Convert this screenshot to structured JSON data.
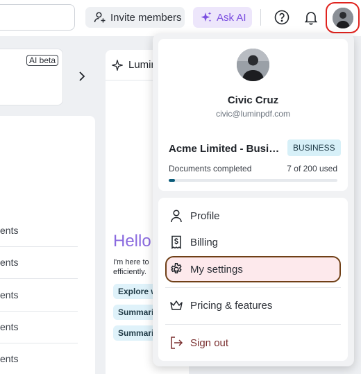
{
  "topbar": {
    "invite_label": "Invite members",
    "ask_ai_label": "Ask AI"
  },
  "background": {
    "ai_beta_label": "AI beta",
    "panel_title": "Lumin",
    "greeting": "Hello",
    "intro_lines": [
      "I'm here to",
      "efficiently."
    ],
    "chips": [
      "Explore w",
      "Summari",
      "Summari"
    ],
    "doc_rows": [
      "ents",
      "ents",
      "ents",
      "ents",
      "ents"
    ]
  },
  "user": {
    "name": "Civic Cruz",
    "email": "civic@luminpdf.com"
  },
  "organization": {
    "name": "Acme Limited - Business",
    "plan": "BUSINESS",
    "docs_label": "Documents completed",
    "docs_count": "7 of 200 used",
    "progress": 0.035
  },
  "menu": {
    "profile": "Profile",
    "billing": "Billing",
    "settings": "My settings",
    "pricing": "Pricing & features",
    "signout": "Sign out"
  },
  "colors": {
    "accent": "#8a6adf",
    "highlight_red": "#e0231e",
    "progress": "#0b5c7a"
  }
}
